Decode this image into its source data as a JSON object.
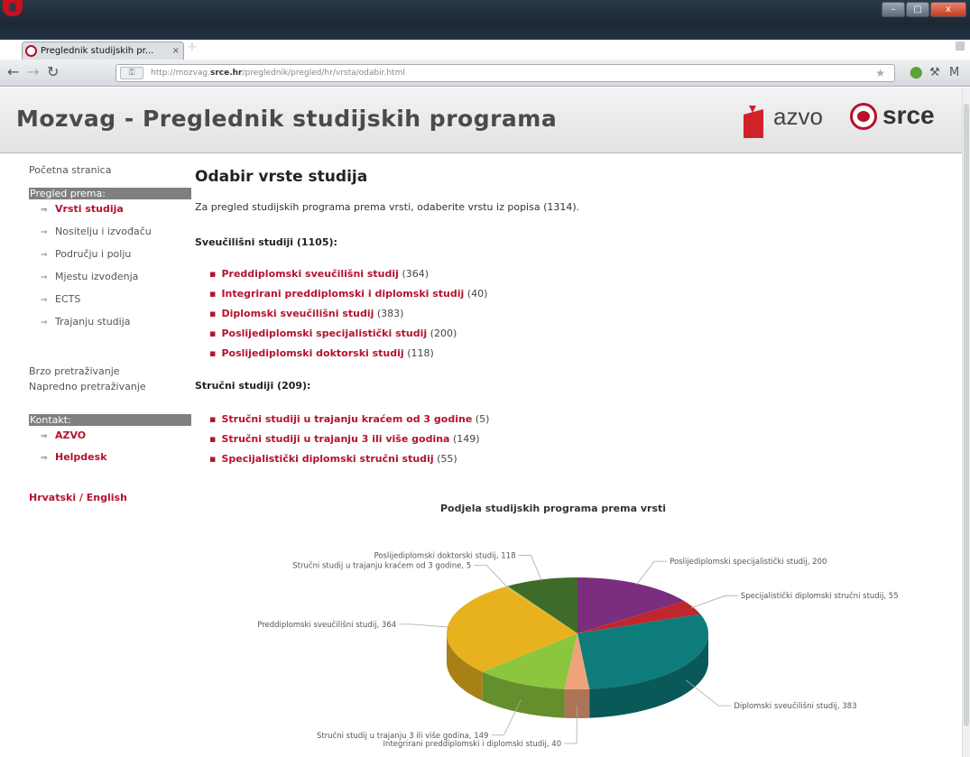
{
  "browser": {
    "tab_title": "Preglednik studijskih pr...",
    "tab_close": "×",
    "new_tab": "+",
    "address_ic": "⚿",
    "address_prefix": "http://mozvag.",
    "address_domain": "srce.hr",
    "address_path": "/preglednik/pregled/hr/vrsta/odabir.html",
    "star": "★",
    "win_minimize": "–",
    "win_maximize": "□",
    "win_close": "x",
    "back_icon": "←",
    "forward_icon": "→",
    "reload_icon": "↻",
    "tools_icons": [
      "⬤",
      "⚒",
      "M"
    ]
  },
  "header": {
    "title": "Mozvag - Preglednik studijskih programa",
    "logo_azvo": "azvo",
    "logo_srce": "srce"
  },
  "sidebar": {
    "home": "Početna stranica",
    "browse_head": "Pregled prema:",
    "browse_items": [
      "Vrsti studija",
      "Nositelju i izvođaču",
      "Području i polju",
      "Mjestu izvođenja",
      "ECTS",
      "Trajanju studija"
    ],
    "quick_search": "Brzo pretraživanje",
    "advanced_search": "Napredno pretraživanje",
    "contact_head": "Kontakt:",
    "contact_items": [
      "AZVO",
      "Helpdesk"
    ],
    "language": "Hrvatski / English",
    "arrow": "⇒"
  },
  "content": {
    "heading": "Odabir vrste studija",
    "intro": "Za pregled studijskih programa prema vrsti, odaberite vrstu iz popisa (1314).",
    "university_head": "Sveučilišni studiji (1105):",
    "university_items": [
      {
        "label": "Preddiplomski sveučilišni studij",
        "count": "(364)"
      },
      {
        "label": "Integrirani preddiplomski i diplomski studij",
        "count": "(40)"
      },
      {
        "label": "Diplomski sveučilišni studij",
        "count": "(383)"
      },
      {
        "label": "Poslijediplomski specijalistički studij",
        "count": "(200)"
      },
      {
        "label": "Poslijediplomski doktorski studij",
        "count": "(118)"
      }
    ],
    "professional_head": "Stručni studiji (209):",
    "professional_items": [
      {
        "label": "Stručni studiji u trajanju kraćem od 3 godine",
        "count": "(5)"
      },
      {
        "label": "Stručni studiji u trajanju 3 ili više godina",
        "count": "(149)"
      },
      {
        "label": "Specijalistički diplomski stručni studij",
        "count": "(55)"
      }
    ],
    "bullet": "▪"
  },
  "chart_data": {
    "type": "pie",
    "title": "Podjela studijskih programa prema vrsti",
    "slices": [
      {
        "name": "Poslijediplomski specijalistički studij",
        "value": 200,
        "color": "#7a2e7d",
        "label": "Poslijediplomski specijalistički studij, 200"
      },
      {
        "name": "Specijalistički diplomski stručni studij",
        "value": 55,
        "color": "#c0262d",
        "label": "Specijalistički diplomski stručni studij, 55"
      },
      {
        "name": "Diplomski sveučilišni studij",
        "value": 383,
        "color": "#0e7c7b",
        "label": "Diplomski sveučilišni studij, 383"
      },
      {
        "name": "Integrirani preddiplomski i diplomski studij",
        "value": 40,
        "color": "#f0a27a",
        "label": "Integrirani preddiplomski i diplomski studij, 40"
      },
      {
        "name": "Stručni studij u trajanju 3 ili više godina",
        "value": 149,
        "color": "#8cc63f",
        "label": "Stručni studij u trajanju 3 ili više godina, 149"
      },
      {
        "name": "Preddiplomski sveučilišni studij",
        "value": 364,
        "color": "#e8b21f",
        "label": "Preddiplomski sveučilišni studij, 364"
      },
      {
        "name": "Stručni studij u trajanju kraćem od 3 godine",
        "value": 5,
        "color": "#d9c13a",
        "label": "Stručni studij u trajanju kraćem od 3 godine, 5"
      },
      {
        "name": "Poslijediplomski doktorski studij",
        "value": 118,
        "color": "#3f6b2a",
        "label": "Poslijediplomski doktorski studij, 118"
      }
    ]
  }
}
